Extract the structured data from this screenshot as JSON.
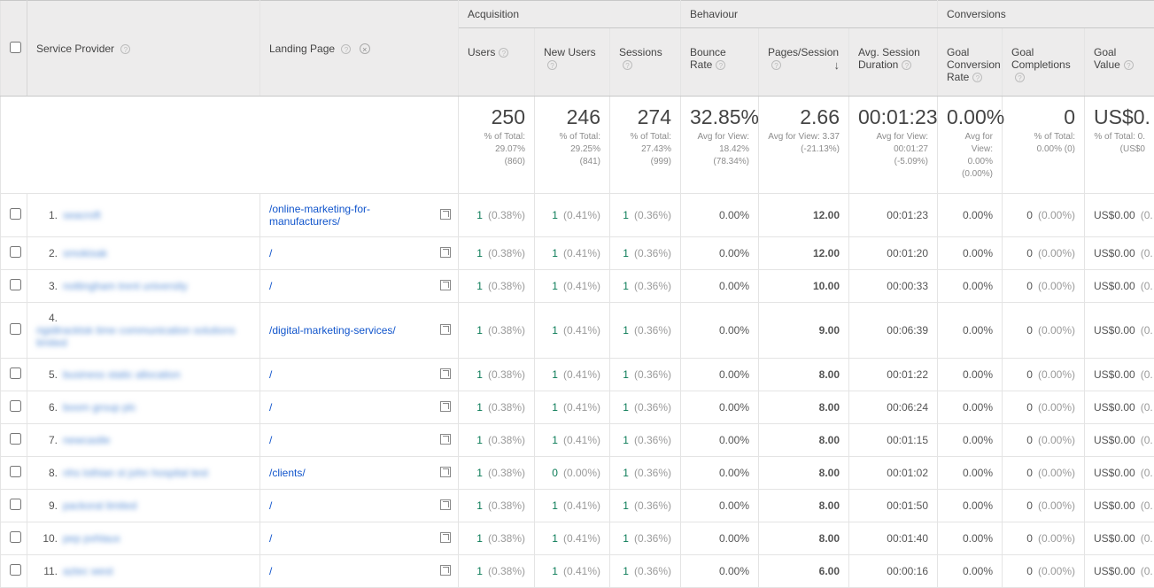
{
  "header": {
    "dimensions": {
      "service_provider": "Service Provider",
      "landing_page": "Landing Page"
    },
    "groups": {
      "acquisition": "Acquisition",
      "behaviour": "Behaviour",
      "conversions": "Conversions"
    },
    "metrics": {
      "users": "Users",
      "new_users": "New Users",
      "sessions": "Sessions",
      "bounce_rate": "Bounce Rate",
      "pages_session": "Pages/Session",
      "avg_session_duration": "Avg. Session Duration",
      "goal_conversion_rate": "Goal Conversion Rate",
      "goal_completions": "Goal Completions",
      "goal_value": "Goal Value"
    },
    "sort": {
      "column": "pages_session",
      "direction": "desc",
      "indicator": "↓"
    }
  },
  "summary": {
    "users": {
      "big": "250",
      "sub1": "% of Total:",
      "sub2": "29.07%",
      "sub3": "(860)"
    },
    "new_users": {
      "big": "246",
      "sub1": "% of Total:",
      "sub2": "29.25%",
      "sub3": "(841)"
    },
    "sessions": {
      "big": "274",
      "sub1": "% of Total:",
      "sub2": "27.43% (999)"
    },
    "bounce_rate": {
      "big": "32.85%",
      "sub1": "Avg for View:",
      "sub2": "18.42%",
      "sub3": "(78.34%)"
    },
    "pages_session": {
      "big": "2.66",
      "sub1": "Avg for View: 3.37",
      "sub2": "(-21.13%)"
    },
    "avg_session_duration": {
      "big": "00:01:23",
      "sub1": "Avg for View:",
      "sub2": "00:01:27",
      "sub3": "(-5.09%)"
    },
    "goal_conversion_rate": {
      "big": "0.00%",
      "sub1": "Avg for",
      "sub2": "View:",
      "sub3": "0.00%",
      "sub4": "(0.00%)"
    },
    "goal_completions": {
      "big": "0",
      "sub1": "% of Total:",
      "sub2": "0.00% (0)"
    },
    "goal_value": {
      "big": "US$0.",
      "sub1": "% of Total: 0.",
      "sub2": "(US$0"
    }
  },
  "rows": [
    {
      "idx": "1.",
      "sp": "seacroft",
      "lp": "/online-marketing-for-manufacturers/",
      "u": "1",
      "up": "(0.38%)",
      "nu": "1",
      "nup": "(0.41%)",
      "s": "1",
      "sp_": "(0.36%)",
      "br": "0.00%",
      "ps": "12.00",
      "asd": "00:01:23",
      "gcr": "0.00%",
      "gc": "0",
      "gcp": "(0.00%)",
      "gv": "US$0.00",
      "gvp": "(0."
    },
    {
      "idx": "2.",
      "sp": "smokisak",
      "lp": "/",
      "u": "1",
      "up": "(0.38%)",
      "nu": "1",
      "nup": "(0.41%)",
      "s": "1",
      "sp_": "(0.36%)",
      "br": "0.00%",
      "ps": "12.00",
      "asd": "00:01:20",
      "gcr": "0.00%",
      "gc": "0",
      "gcp": "(0.00%)",
      "gv": "US$0.00",
      "gvp": "(0."
    },
    {
      "idx": "3.",
      "sp": "nottingham trent university",
      "lp": "/",
      "u": "1",
      "up": "(0.38%)",
      "nu": "1",
      "nup": "(0.41%)",
      "s": "1",
      "sp_": "(0.36%)",
      "br": "0.00%",
      "ps": "10.00",
      "asd": "00:00:33",
      "gcr": "0.00%",
      "gc": "0",
      "gcp": "(0.00%)",
      "gv": "US$0.00",
      "gvp": "(0."
    },
    {
      "idx": "4.",
      "sp": "rigidtracktsk time communication solutions limited",
      "lp": "/digital-marketing-services/",
      "u": "1",
      "up": "(0.38%)",
      "nu": "1",
      "nup": "(0.41%)",
      "s": "1",
      "sp_": "(0.36%)",
      "br": "0.00%",
      "ps": "9.00",
      "asd": "00:06:39",
      "gcr": "0.00%",
      "gc": "0",
      "gcp": "(0.00%)",
      "gv": "US$0.00",
      "gvp": "(0."
    },
    {
      "idx": "5.",
      "sp": "business static allocation",
      "lp": "/",
      "u": "1",
      "up": "(0.38%)",
      "nu": "1",
      "nup": "(0.41%)",
      "s": "1",
      "sp_": "(0.36%)",
      "br": "0.00%",
      "ps": "8.00",
      "asd": "00:01:22",
      "gcr": "0.00%",
      "gc": "0",
      "gcp": "(0.00%)",
      "gv": "US$0.00",
      "gvp": "(0."
    },
    {
      "idx": "6.",
      "sp": "boom group plc",
      "lp": "/",
      "u": "1",
      "up": "(0.38%)",
      "nu": "1",
      "nup": "(0.41%)",
      "s": "1",
      "sp_": "(0.36%)",
      "br": "0.00%",
      "ps": "8.00",
      "asd": "00:06:24",
      "gcr": "0.00%",
      "gc": "0",
      "gcp": "(0.00%)",
      "gv": "US$0.00",
      "gvp": "(0."
    },
    {
      "idx": "7.",
      "sp": "newcastle",
      "lp": "/",
      "u": "1",
      "up": "(0.38%)",
      "nu": "1",
      "nup": "(0.41%)",
      "s": "1",
      "sp_": "(0.36%)",
      "br": "0.00%",
      "ps": "8.00",
      "asd": "00:01:15",
      "gcr": "0.00%",
      "gc": "0",
      "gcp": "(0.00%)",
      "gv": "US$0.00",
      "gvp": "(0."
    },
    {
      "idx": "8.",
      "sp": "nhs lothian st john hospital test",
      "lp": "/clients/",
      "u": "1",
      "up": "(0.38%)",
      "nu": "0",
      "nup": "(0.00%)",
      "s": "1",
      "sp_": "(0.36%)",
      "br": "0.00%",
      "ps": "8.00",
      "asd": "00:01:02",
      "gcr": "0.00%",
      "gc": "0",
      "gcp": "(0.00%)",
      "gv": "US$0.00",
      "gvp": "(0."
    },
    {
      "idx": "9.",
      "sp": "packoral limited",
      "lp": "/",
      "u": "1",
      "up": "(0.38%)",
      "nu": "1",
      "nup": "(0.41%)",
      "s": "1",
      "sp_": "(0.36%)",
      "br": "0.00%",
      "ps": "8.00",
      "asd": "00:01:50",
      "gcr": "0.00%",
      "gc": "0",
      "gcp": "(0.00%)",
      "gv": "US$0.00",
      "gvp": "(0."
    },
    {
      "idx": "10.",
      "sp": "pep pvhlaux",
      "lp": "/",
      "u": "1",
      "up": "(0.38%)",
      "nu": "1",
      "nup": "(0.41%)",
      "s": "1",
      "sp_": "(0.36%)",
      "br": "0.00%",
      "ps": "8.00",
      "asd": "00:01:40",
      "gcr": "0.00%",
      "gc": "0",
      "gcp": "(0.00%)",
      "gv": "US$0.00",
      "gvp": "(0."
    },
    {
      "idx": "11.",
      "sp": "aztec west",
      "lp": "/",
      "u": "1",
      "up": "(0.38%)",
      "nu": "1",
      "nup": "(0.41%)",
      "s": "1",
      "sp_": "(0.36%)",
      "br": "0.00%",
      "ps": "6.00",
      "asd": "00:00:16",
      "gcr": "0.00%",
      "gc": "0",
      "gcp": "(0.00%)",
      "gv": "US$0.00",
      "gvp": "(0."
    }
  ]
}
